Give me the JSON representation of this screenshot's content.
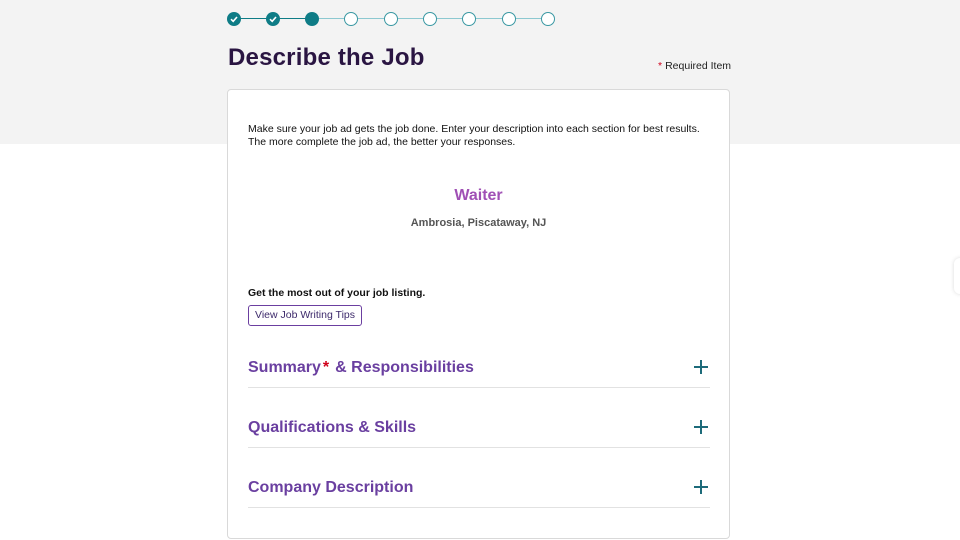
{
  "stepper": {
    "steps": [
      "done",
      "done",
      "current",
      "todo",
      "todo",
      "todo",
      "todo",
      "todo",
      "todo"
    ]
  },
  "page": {
    "title": "Describe the Job",
    "required_star": "*",
    "required_note": "Required Item"
  },
  "card": {
    "intro": "Make sure your job ad gets the job done. Enter your description into each section for best results. The more complete the job ad, the better your responses.",
    "job_title": "Waiter",
    "job_location": "Ambrosia, Piscataway, NJ",
    "tips_label": "Get the most out of your job listing.",
    "tips_button": "View Job Writing Tips"
  },
  "sections": [
    {
      "title_a": "Summary",
      "required": "*",
      "title_b": "& Responsibilities",
      "icon": "plus-icon"
    },
    {
      "title": "Qualifications & Skills",
      "icon": "plus-icon"
    },
    {
      "title": "Company Description",
      "icon": "plus-icon"
    }
  ],
  "colors": {
    "accent_teal": "#0e7c86",
    "heading_purple": "#6a3fa0",
    "job_title_pink": "#a050b5",
    "required_red": "#d0021b"
  }
}
